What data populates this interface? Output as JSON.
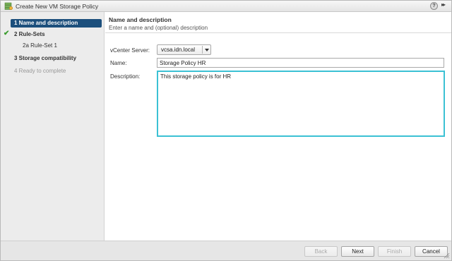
{
  "window": {
    "title": "Create New VM Storage Policy",
    "help_icon": "question-icon",
    "expand_icon": "double-chevron-right-icon"
  },
  "sidebar": {
    "steps": [
      {
        "label": "1  Name and description",
        "state": "active",
        "completed": true
      },
      {
        "label": "2  Rule-Sets",
        "state": "bold"
      },
      {
        "label": "2a  Rule-Set 1",
        "state": "sub"
      },
      {
        "label": "3  Storage compatibility",
        "state": "bold"
      },
      {
        "label": "4  Ready to complete",
        "state": "disabled"
      }
    ]
  },
  "header": {
    "title": "Name and description",
    "subtitle": "Enter a name and (optional) description"
  },
  "form": {
    "vcenter_label": "vCenter Server:",
    "vcenter_value": "vcsa.idn.local",
    "name_label": "Name:",
    "name_value": "Storage Policy HR",
    "description_label": "Description:",
    "description_value": "This storage policy is for HR"
  },
  "footer": {
    "back_label": "Back",
    "next_label": "Next",
    "finish_label": "Finish",
    "cancel_label": "Cancel"
  },
  "colors": {
    "active_step": "#1c4f7c",
    "focus_border": "#3bc1d4",
    "check": "#3a9c2e"
  }
}
